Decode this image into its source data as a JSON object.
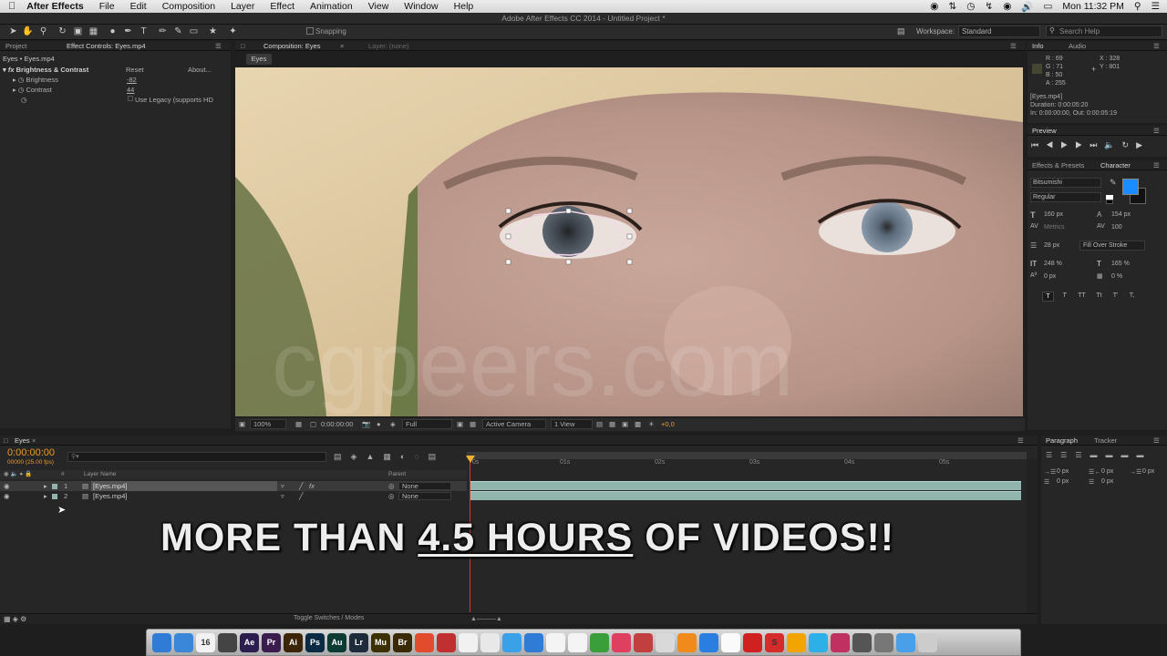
{
  "menubar": {
    "app_name": "After Effects",
    "items": [
      "File",
      "Edit",
      "Composition",
      "Layer",
      "Effect",
      "Animation",
      "View",
      "Window",
      "Help"
    ],
    "clock": "Mon 11:32 PM"
  },
  "window_title": "Adobe After Effects CC 2014 - Untitled Project *",
  "toolbar": {
    "snapping_label": "Snapping",
    "workspace_label": "Workspace:",
    "workspace_value": "Standard",
    "search_placeholder": "Search Help"
  },
  "effect_controls": {
    "tab_project": "Project",
    "tab_label": "Effect Controls: Eyes.mp4",
    "layer_path": "Eyes • Eyes.mp4",
    "effect_name": "Brightness & Contrast",
    "reset_label": "Reset",
    "about_label": "About...",
    "brightness_label": "Brightness",
    "brightness_value": "-82",
    "contrast_label": "Contrast",
    "contrast_value": "44",
    "legacy_label": "Use Legacy (supports HD"
  },
  "composition": {
    "tab_label": "Composition: Eyes",
    "layer_tab": "Layer: (none)",
    "comp_button": "Eyes",
    "watermark": "cgpeers.com",
    "zoom": "100%",
    "timecode": "0:00:00:00",
    "resolution": "Full",
    "camera": "Active Camera",
    "views": "1 View",
    "exposure": "+0,0"
  },
  "info": {
    "tab_info": "Info",
    "tab_audio": "Audio",
    "r": "R : 69",
    "g": "G : 71",
    "b": "B : 50",
    "a": "A : 255",
    "x": "X : 328",
    "y": "Y : 801",
    "file": "[Eyes.mp4]",
    "duration": "Duration: 0:00:05:20",
    "inout": "In: 0:00:00:00, Out: 0:00:05:19",
    "swatch_color": "#454732"
  },
  "preview": {
    "tab": "Preview"
  },
  "character": {
    "tab_effects": "Effects & Presets",
    "tab_character": "Character",
    "font": "Bitsumishi",
    "style": "Regular",
    "size": "160 px",
    "leading": "154 px",
    "kerning": "Metrics",
    "tracking": "100",
    "stroke_width": "28 px",
    "stroke_type": "Fill Over Stroke",
    "vscale": "248 %",
    "hscale": "165 %",
    "baseline": "0 px",
    "tsume": "0 %",
    "fill_color": "#1a8cff",
    "style_buttons": [
      "T",
      "T",
      "TT",
      "Tt",
      "T'",
      "T,"
    ]
  },
  "paragraph": {
    "tab_paragraph": "Paragraph",
    "tab_tracker": "Tracker",
    "indent_left": "0 px",
    "indent_right": "0 px",
    "indent_first": "0 px",
    "space_before": "0 px",
    "space_after": "0 px"
  },
  "timeline": {
    "tab_label": "Eyes",
    "timecode": "0:00:00:00",
    "fps": "00000 (25.00 fps)",
    "col_layer_name": "Layer Name",
    "col_parent": "Parent",
    "col_num": "#",
    "ruler": [
      "0s",
      "01s",
      "02s",
      "03s",
      "04s",
      "05s"
    ],
    "layers": [
      {
        "num": "1",
        "name": "[Eyes.mp4]",
        "parent": "None"
      },
      {
        "num": "2",
        "name": "[Eyes.mp4]",
        "parent": "None"
      }
    ],
    "toggle_label": "Toggle Switches / Modes"
  },
  "banner": {
    "before": "MORE THAN ",
    "underlined": "4.5 HOURS",
    "after": " OF VIDEOS!!"
  },
  "dock": {
    "apps": [
      {
        "label": "",
        "color": "#2f7bd6"
      },
      {
        "label": "",
        "color": "#3a86d8"
      },
      {
        "label": "16",
        "color": "#f2f2f2"
      },
      {
        "label": "",
        "color": "#444"
      },
      {
        "label": "Ae",
        "color": "#2b1e4f"
      },
      {
        "label": "Pr",
        "color": "#3a1c4f"
      },
      {
        "label": "Ai",
        "color": "#3b2408"
      },
      {
        "label": "Ps",
        "color": "#0b2a43"
      },
      {
        "label": "Au",
        "color": "#0d3a33"
      },
      {
        "label": "Lr",
        "color": "#1d2b3a"
      },
      {
        "label": "Mu",
        "color": "#3a3000"
      },
      {
        "label": "Br",
        "color": "#3a2a06"
      },
      {
        "label": "",
        "color": "#e24b2b"
      },
      {
        "label": "",
        "color": "#c03030"
      },
      {
        "label": "",
        "color": "#f1f1f1"
      },
      {
        "label": "",
        "color": "#e8e8e8"
      },
      {
        "label": "",
        "color": "#3aa0e8"
      },
      {
        "label": "",
        "color": "#2f7bd6"
      },
      {
        "label": "",
        "color": "#f4f4f4"
      },
      {
        "label": "",
        "color": "#f4f4f4"
      },
      {
        "label": "",
        "color": "#3a9e3a"
      },
      {
        "label": "",
        "color": "#e04060"
      },
      {
        "label": "",
        "color": "#c23f3f"
      },
      {
        "label": "",
        "color": "#d9d9d9"
      },
      {
        "label": "",
        "color": "#f08a1a"
      },
      {
        "label": "",
        "color": "#2a7de1"
      },
      {
        "label": "",
        "color": "#fafafa"
      },
      {
        "label": "",
        "color": "#d02020"
      },
      {
        "label": "S",
        "color": "#d42b2b"
      },
      {
        "label": "",
        "color": "#f2a500"
      },
      {
        "label": "",
        "color": "#2db0e8"
      },
      {
        "label": "",
        "color": "#c03060"
      },
      {
        "label": "",
        "color": "#555"
      },
      {
        "label": "",
        "color": "#777"
      },
      {
        "label": "",
        "color": "#4aa0e8"
      },
      {
        "label": "",
        "color": "#cccccc"
      }
    ]
  }
}
